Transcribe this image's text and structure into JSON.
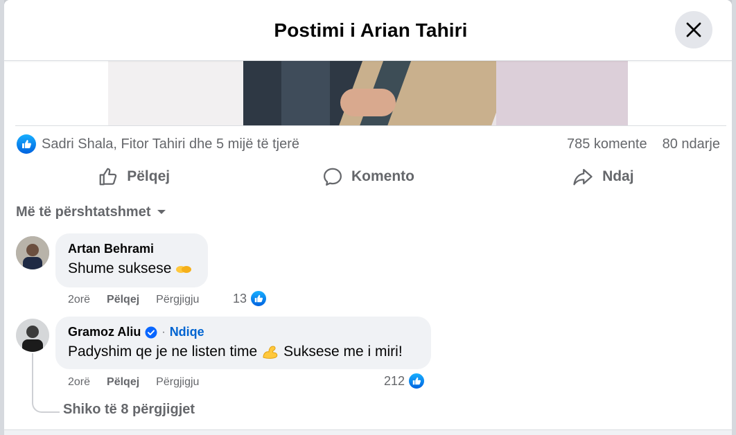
{
  "dialog": {
    "title": "Postimi i Arian Tahiri",
    "close_icon": "close-icon"
  },
  "post_stats": {
    "reactions_text": "Sadri Shala, Fitor Tahiri dhe 5 mijë të tjerë",
    "comments_text": "785 komente",
    "shares_text": "80 ndarje"
  },
  "actions": {
    "like_label": "Pëlqej",
    "comment_label": "Komento",
    "share_label": "Ndaj"
  },
  "sort": {
    "label": "Më të përshtatshmet"
  },
  "comments": [
    {
      "author": "Artan Behrami",
      "text": "Shume suksese",
      "emoji": "clapping-hands-icon",
      "time": "2orë",
      "like_label": "Pëlqej",
      "reply_label": "Përgjigju",
      "reactions": "13"
    },
    {
      "author": "Gramoz Aliu",
      "verified": true,
      "separator": "·",
      "follow_label": "Ndiqe",
      "text_before": "Padyshim qe je ne listen time",
      "text_after": "Suksese me i miri!",
      "emoji": "flexed-biceps-icon",
      "time": "2orë",
      "like_label": "Pëlqej",
      "reply_label": "Përgjigju",
      "reactions": "212",
      "view_replies": "Shiko të 8 përgjigjet"
    }
  ],
  "colors": {
    "accent": "#0866ff",
    "text_primary": "#050505",
    "text_secondary": "#65676b",
    "bubble_bg": "#f0f2f5"
  }
}
